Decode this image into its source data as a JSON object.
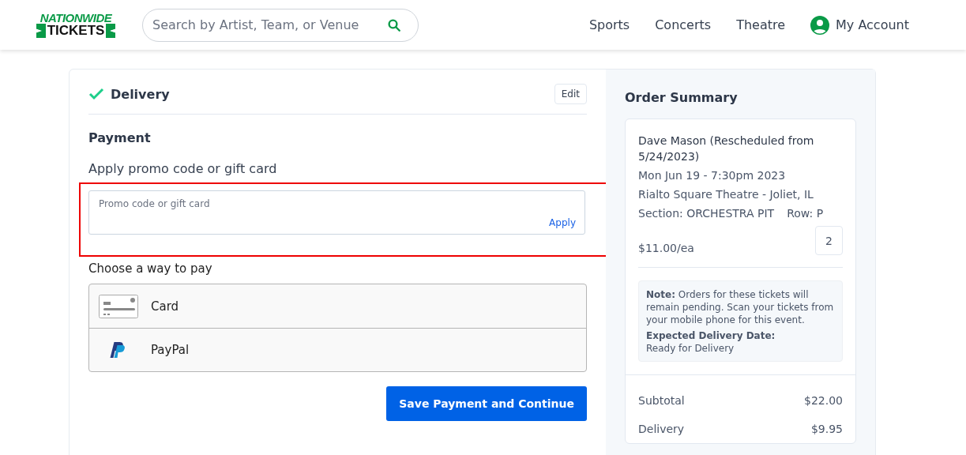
{
  "header": {
    "logo": {
      "top": "NATIONWIDE",
      "bottom": "TICKETS"
    },
    "search": {
      "placeholder": "Search by Artist, Team, or Venue"
    },
    "nav": [
      "Sports",
      "Concerts",
      "Theatre"
    ],
    "account": "My Account"
  },
  "delivery": {
    "title": "Delivery",
    "done": true,
    "edit": "Edit"
  },
  "payment": {
    "title": "Payment",
    "promo_label": "Apply promo code or gift card",
    "promo_field": {
      "placeholder": "Promo code or gift card",
      "action": "Apply"
    },
    "choose_label": "Choose a way to pay",
    "methods": [
      {
        "kind": "card",
        "label": "Card"
      },
      {
        "kind": "paypal",
        "label": "PayPal"
      }
    ],
    "submit": "Save Payment and Continue"
  },
  "summary": {
    "title": "Order Summary",
    "event": "Dave Mason (Rescheduled from 5/24/2023)",
    "date": "Mon Jun 19 - 7:30pm 2023",
    "venue": "Rialto Square Theatre - Joliet, IL",
    "section": "Section: ORCHESTRA PIT",
    "row": "Row: P",
    "price": "$11.00/ea",
    "quantity": "2",
    "note": "**Note:** Orders for these tickets will remain pending. Scan your tickets from your mobile phone for this event.",
    "delivery_date_label": "Expected Delivery Date:",
    "delivery_date": "Ready for Delivery",
    "totals": [
      {
        "label": "Subtotal",
        "value": "$22.00"
      },
      {
        "label": "Delivery",
        "value": "$9.95"
      }
    ]
  }
}
